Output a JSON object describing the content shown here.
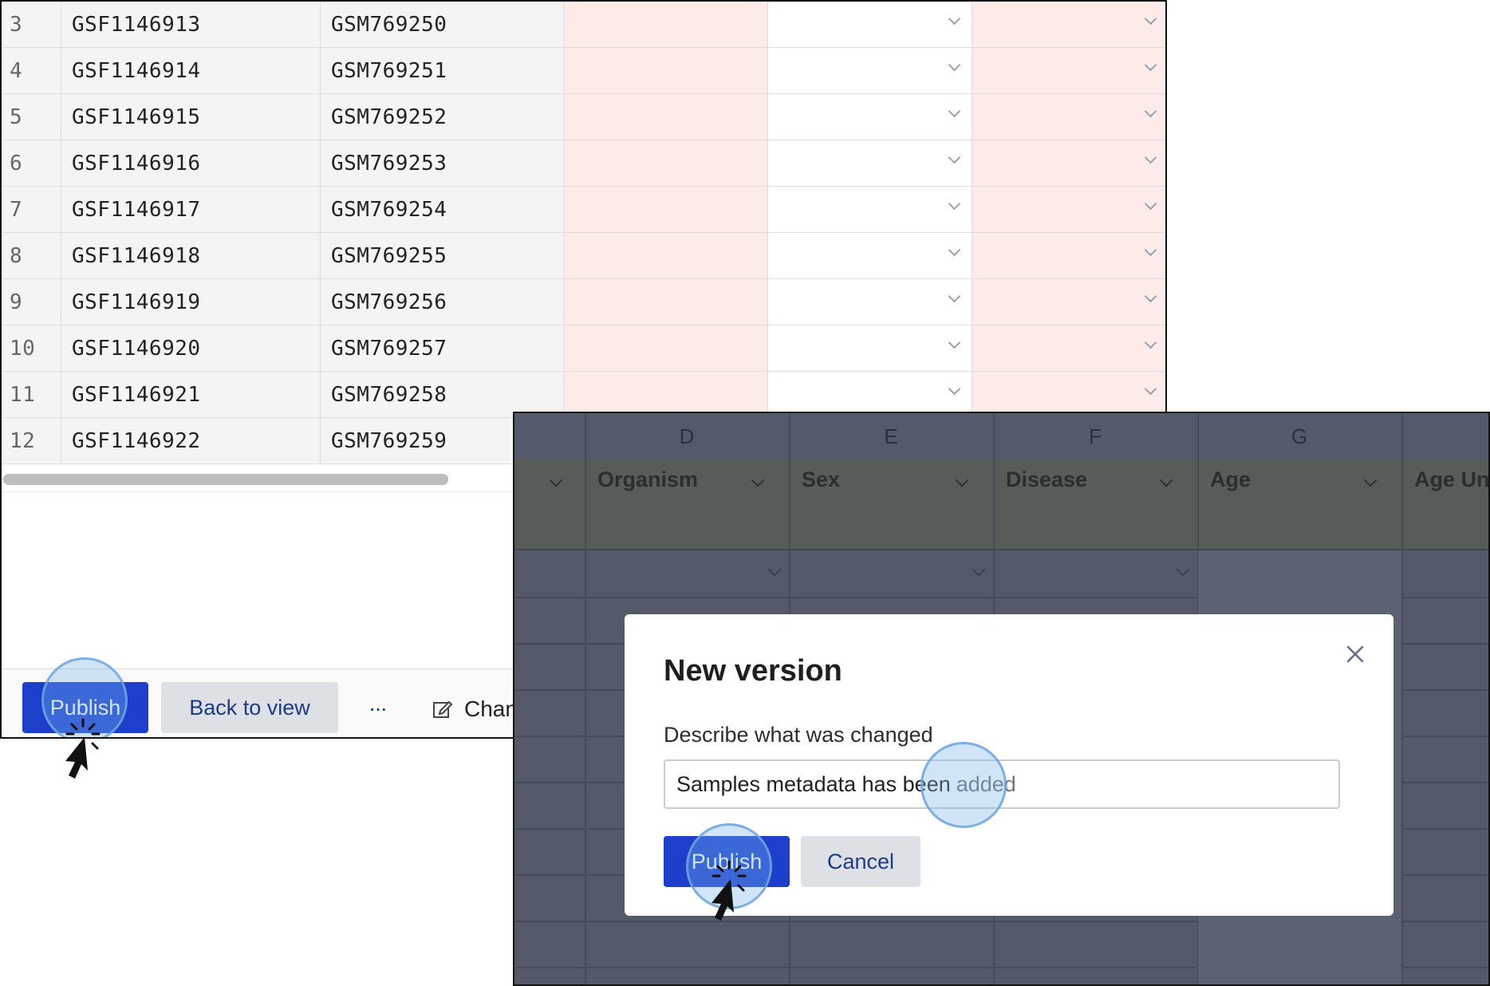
{
  "spreadsheet": {
    "rows": [
      {
        "n": "3",
        "id1": "GSF1146913",
        "id2": "GSM769250"
      },
      {
        "n": "4",
        "id1": "GSF1146914",
        "id2": "GSM769251"
      },
      {
        "n": "5",
        "id1": "GSF1146915",
        "id2": "GSM769252"
      },
      {
        "n": "6",
        "id1": "GSF1146916",
        "id2": "GSM769253"
      },
      {
        "n": "7",
        "id1": "GSF1146917",
        "id2": "GSM769254"
      },
      {
        "n": "8",
        "id1": "GSF1146918",
        "id2": "GSM769255"
      },
      {
        "n": "9",
        "id1": "GSF1146919",
        "id2": "GSM769256"
      },
      {
        "n": "10",
        "id1": "GSF1146920",
        "id2": "GSM769257"
      },
      {
        "n": "11",
        "id1": "GSF1146921",
        "id2": "GSM769258"
      },
      {
        "n": "12",
        "id1": "GSF1146922",
        "id2": "GSM769259"
      }
    ]
  },
  "toolbar": {
    "publish_label": "Publish",
    "back_label": "Back to view",
    "more_label": "···",
    "changes_label": "Chan"
  },
  "columns": [
    {
      "letter": "D",
      "name": "Organism"
    },
    {
      "letter": "E",
      "name": "Sex"
    },
    {
      "letter": "F",
      "name": "Disease"
    },
    {
      "letter": "G",
      "name": "Age"
    },
    {
      "letter": "",
      "name": "Age Un"
    }
  ],
  "dialog": {
    "title": "New version",
    "field_label": "Describe what was changed",
    "input_value_typed": "Samples metadata has been",
    "input_value_suggest": "added",
    "publish_label": "Publish",
    "cancel_label": "Cancel"
  },
  "colors": {
    "accent": "#1d3fcc",
    "error_fill": "#fcebe8",
    "overlay": "#555a68"
  }
}
